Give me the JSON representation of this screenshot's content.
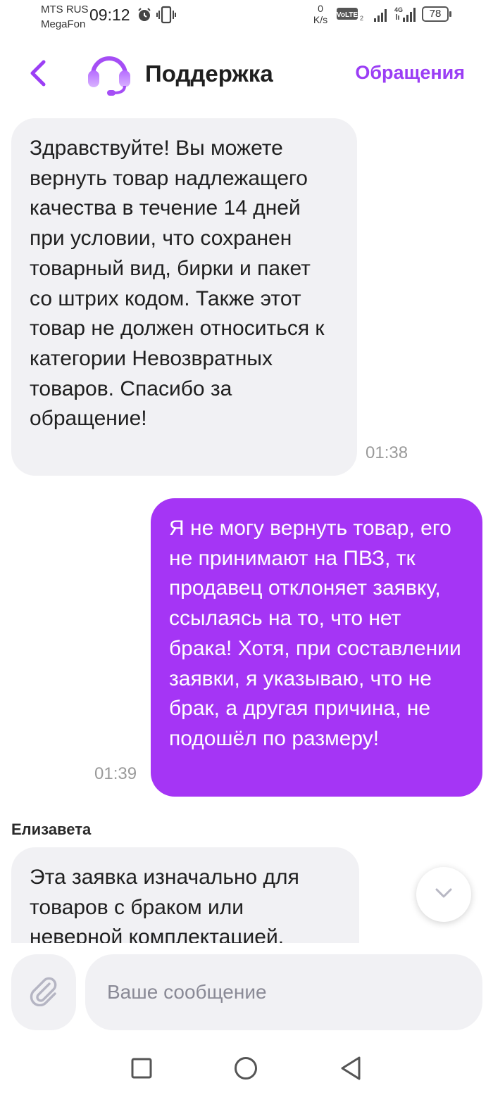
{
  "status_bar": {
    "carrier1": "MTS RUS",
    "carrier2": "MegaFon",
    "time": "09:12",
    "speed_value": "0",
    "speed_unit": "K/s",
    "volte": "VoLTE",
    "network": "4G",
    "battery": "78"
  },
  "header": {
    "title": "Поддержка",
    "appeals_link": "Обращения"
  },
  "messages": [
    {
      "direction": "incoming",
      "text": "Здравствуйте! Вы можете вернуть товар надлежащего качества в течение 14 дней при условии, что сохранен товарный вид, бирки и пакет со штрих кодом. Также этот товар не должен относиться к категории Невозвратных товаров. Спасибо за обращение!",
      "time": "01:38"
    },
    {
      "direction": "outgoing",
      "text": "Я не могу вернуть товар, его не принимают на ПВЗ, тк продавец отклоняет заявку, ссылаясь на то, что нет брака! Хотя, при составлении заявки, я указываю, что не брак, а другая причина, не подошёл по размеру!",
      "time": "01:39"
    },
    {
      "direction": "incoming",
      "sender": "Елизавета",
      "text": "Эта заявка изначально для товаров с браком или неверной комплектацией."
    }
  ],
  "composer": {
    "placeholder": "Ваше сообщение"
  },
  "colors": {
    "accent": "#9b3ef5",
    "outgoing_bubble": "#a535f5",
    "incoming_bubble": "#f1f1f4"
  }
}
